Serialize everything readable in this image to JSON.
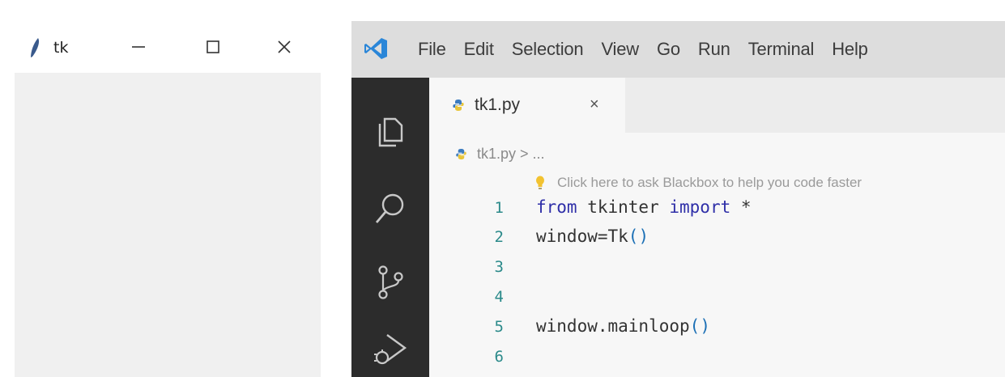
{
  "tk_window": {
    "title": "tk",
    "feather_icon": "tk-feather-icon",
    "controls": {
      "minimize": "minimize-icon",
      "maximize": "maximize-icon",
      "close": "close-icon"
    }
  },
  "vscode": {
    "logo": "vscode-logo-icon",
    "menu": [
      "File",
      "Edit",
      "Selection",
      "View",
      "Go",
      "Run",
      "Terminal",
      "Help"
    ],
    "activity_bar": [
      "explorer-icon",
      "search-icon",
      "source-control-icon",
      "run-debug-icon"
    ],
    "tab": {
      "label": "tk1.py",
      "close": "×"
    },
    "breadcrumb": "tk1.py > ...",
    "hint": "Click here to ask Blackbox to help you code faster",
    "code": {
      "line_numbers": [
        "1",
        "2",
        "3",
        "4",
        "5",
        "6"
      ],
      "line1": {
        "kw1": "from",
        "mod": " tkinter ",
        "kw2": "import",
        "rest": " *"
      },
      "line2": {
        "name": "window=Tk",
        "open": "(",
        "close": ")"
      },
      "line5": {
        "name": "window.mainloop",
        "open": "(",
        "close": ")"
      }
    },
    "colors": {
      "activity_bar": "#2c2c2c",
      "menubar": "#dddddd",
      "keyword": "#2f2fa8",
      "line_number": "#2b8a8a"
    }
  }
}
